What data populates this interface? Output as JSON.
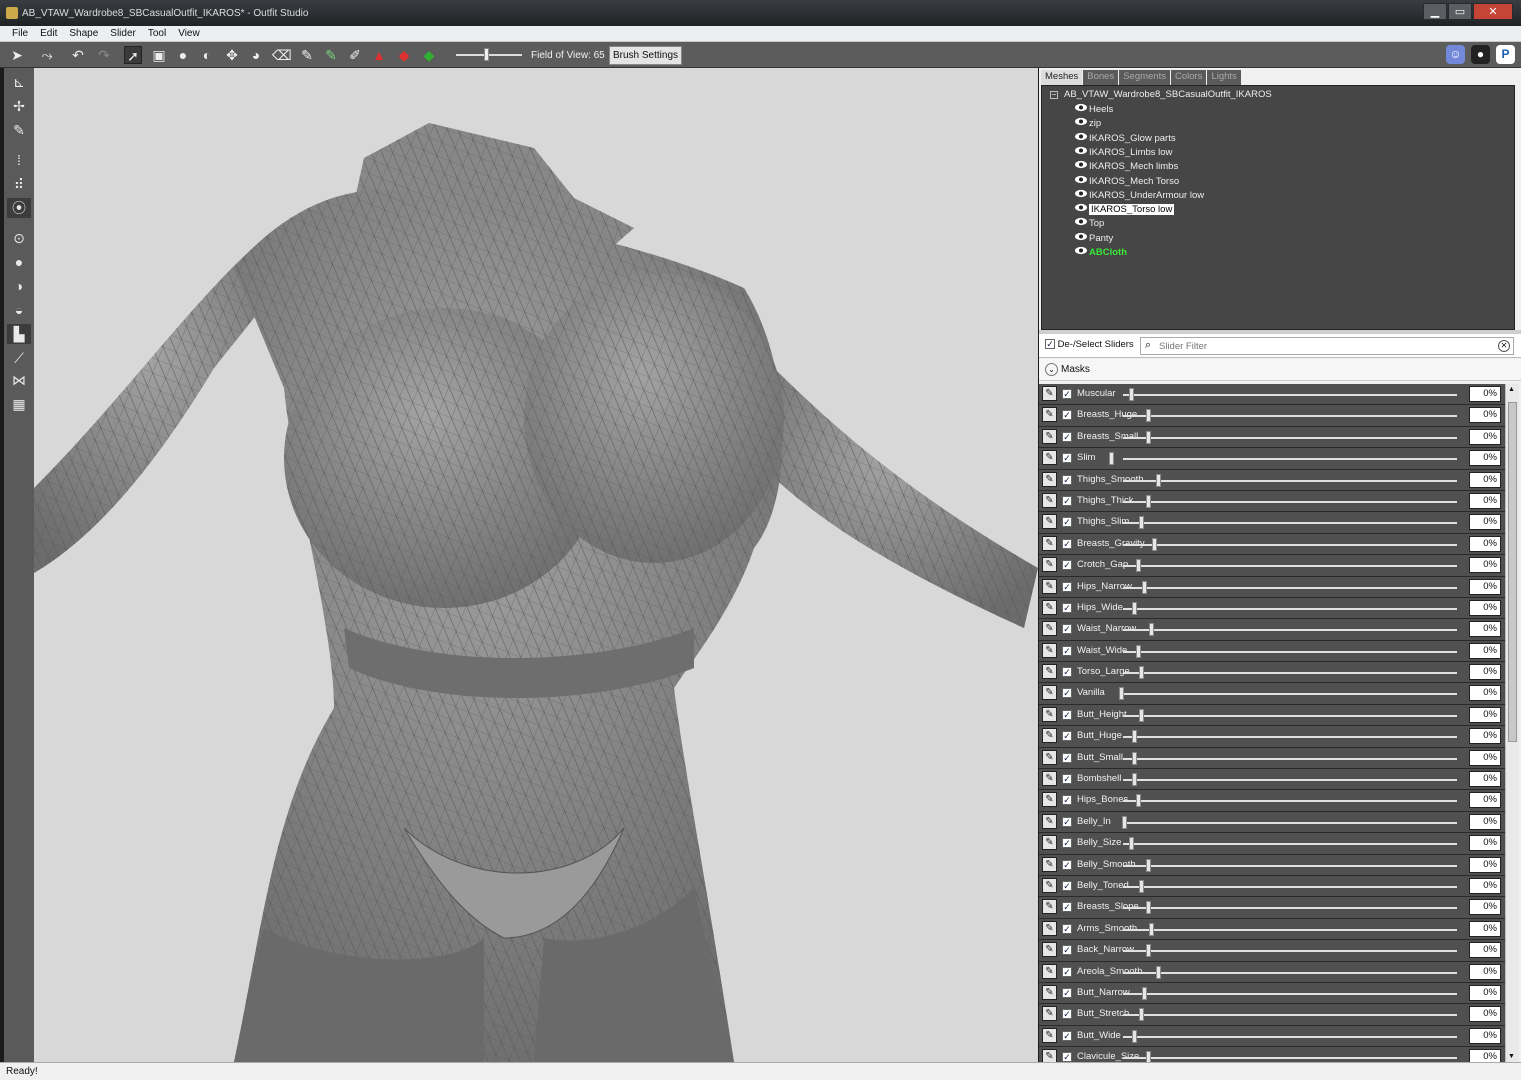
{
  "window": {
    "title": "AB_VTAW_Wardrobe8_SBCasualOutfit_IKAROS* - Outfit Studio",
    "minimize": "▁",
    "maximize": "▭",
    "close": "✕"
  },
  "menu": [
    "File",
    "Edit",
    "Shape",
    "Slider",
    "Tool",
    "View"
  ],
  "toolbar": {
    "fov_label": "Field of View: 65",
    "fov_value": 65,
    "brush_settings": "Brush Settings"
  },
  "panel": {
    "tabs": [
      "Meshes",
      "Bones",
      "Segments",
      "Colors",
      "Lights"
    ],
    "active_tab": "Meshes",
    "tree": {
      "root": "AB_VTAW_Wardrobe8_SBCasualOutfit_IKAROS",
      "items": [
        {
          "label": "Heels"
        },
        {
          "label": "zip"
        },
        {
          "label": "IKAROS_Glow parts"
        },
        {
          "label": "IKAROS_Limbs low"
        },
        {
          "label": "IKAROS_Mech limbs"
        },
        {
          "label": "IKAROS_Mech Torso"
        },
        {
          "label": "IKAROS_UnderArmour low"
        },
        {
          "label": "IKAROS_Torso low",
          "selected": true
        },
        {
          "label": "Top"
        },
        {
          "label": "Panty"
        },
        {
          "label": "ABCloth",
          "cloth": true
        }
      ]
    },
    "deselect_label": "De-/Select Sliders",
    "filter_placeholder": "Slider Filter",
    "masks_label": "Masks",
    "sliders": [
      {
        "name": "Muscular",
        "pct": "0%",
        "pos": 0.0
      },
      {
        "name": "Breasts_Huge",
        "pct": "0%",
        "pos": 0.05
      },
      {
        "name": "Breasts_Small",
        "pct": "0%",
        "pos": 0.05
      },
      {
        "name": "Slim",
        "pct": "0%",
        "pos": -0.06
      },
      {
        "name": "Thighs_Smooth",
        "pct": "0%",
        "pos": 0.08
      },
      {
        "name": "Thighs_Thick",
        "pct": "0%",
        "pos": 0.05
      },
      {
        "name": "Thighs_Slim",
        "pct": "0%",
        "pos": 0.03
      },
      {
        "name": "Breasts_Gravity",
        "pct": "0%",
        "pos": 0.07
      },
      {
        "name": "Crotch_Gap",
        "pct": "0%",
        "pos": 0.02
      },
      {
        "name": "Hips_Narrow",
        "pct": "0%",
        "pos": 0.04
      },
      {
        "name": "Hips_Wide",
        "pct": "0%",
        "pos": 0.01
      },
      {
        "name": "Waist_Narrow",
        "pct": "0%",
        "pos": 0.06
      },
      {
        "name": "Waist_Wide",
        "pct": "0%",
        "pos": 0.02
      },
      {
        "name": "Torso_Large",
        "pct": "0%",
        "pos": 0.03
      },
      {
        "name": "Vanilla",
        "pct": "0%",
        "pos": -0.03
      },
      {
        "name": "Butt_Height",
        "pct": "0%",
        "pos": 0.03
      },
      {
        "name": "Butt_Huge",
        "pct": "0%",
        "pos": 0.01
      },
      {
        "name": "Butt_Small",
        "pct": "0%",
        "pos": 0.01
      },
      {
        "name": "Bombshell",
        "pct": "0%",
        "pos": 0.01
      },
      {
        "name": "Hips_Bones",
        "pct": "0%",
        "pos": 0.02
      },
      {
        "name": "Belly_In",
        "pct": "0%",
        "pos": -0.02
      },
      {
        "name": "Belly_Size",
        "pct": "0%",
        "pos": 0.0
      },
      {
        "name": "Belly_Smooth",
        "pct": "0%",
        "pos": 0.05
      },
      {
        "name": "Belly_Toned",
        "pct": "0%",
        "pos": 0.03
      },
      {
        "name": "Breasts_Slope",
        "pct": "0%",
        "pos": 0.05
      },
      {
        "name": "Arms_Smooth",
        "pct": "0%",
        "pos": 0.06
      },
      {
        "name": "Back_Narrow",
        "pct": "0%",
        "pos": 0.05
      },
      {
        "name": "Areola_Smooth",
        "pct": "0%",
        "pos": 0.08
      },
      {
        "name": "Butt_Narrow",
        "pct": "0%",
        "pos": 0.04
      },
      {
        "name": "Butt_Stretch",
        "pct": "0%",
        "pos": 0.03
      },
      {
        "name": "Butt_Wide",
        "pct": "0%",
        "pos": 0.01
      },
      {
        "name": "Clavicule_Size",
        "pct": "0%",
        "pos": 0.05
      }
    ]
  },
  "status": "Ready!",
  "icons": {
    "toolbar": [
      "select-icon",
      "transform-icon",
      "undo-icon",
      "redo-icon",
      "brush-select-icon",
      "mask-icon",
      "inflate-icon",
      "deflate-icon",
      "move-icon",
      "smooth-icon",
      "eraser-icon",
      "pen-icon",
      "weight-icon",
      "color-icon",
      "triangle-icon",
      "diamond-red-icon",
      "diamond-green-icon"
    ],
    "right": [
      "discord-icon",
      "github-icon",
      "paypal-icon"
    ]
  },
  "colors": {
    "cloth_green": "#38e838",
    "viewport_bg": "#d8d8d8",
    "panel_dark": "#464646"
  }
}
